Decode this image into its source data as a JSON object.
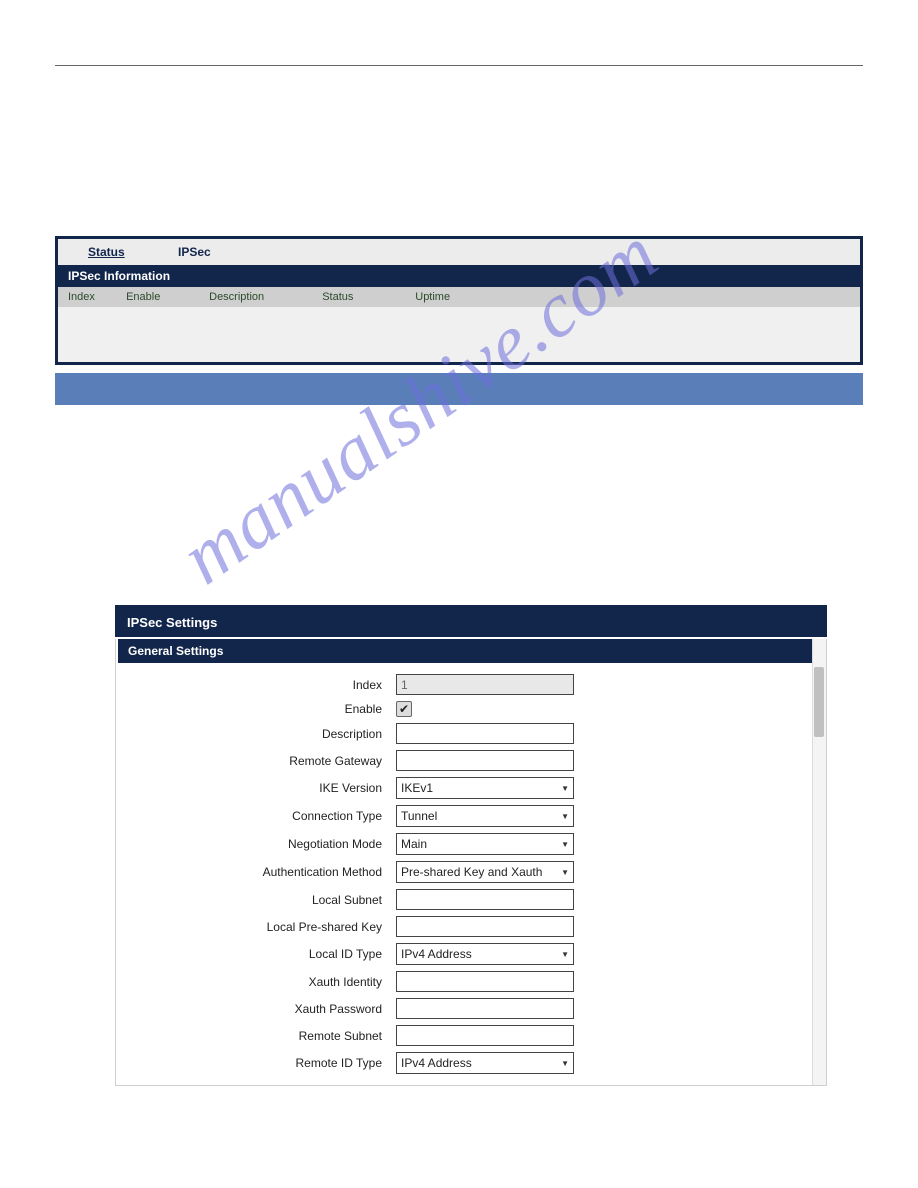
{
  "watermark": "manualshive.com",
  "ipsec_info": {
    "tabs": {
      "status": "Status",
      "ipsec": "IPSec"
    },
    "header": "IPSec Information",
    "columns": {
      "index": "Index",
      "enable": "Enable",
      "description": "Description",
      "status": "Status",
      "uptime": "Uptime"
    }
  },
  "ipsec_settings": {
    "title": "IPSec Settings",
    "general_header": "General Settings",
    "fields": {
      "index": {
        "label": "Index",
        "value": "1"
      },
      "enable": {
        "label": "Enable",
        "checked": true
      },
      "description": {
        "label": "Description",
        "value": ""
      },
      "remote_gateway": {
        "label": "Remote Gateway",
        "value": ""
      },
      "ike_version": {
        "label": "IKE Version",
        "value": "IKEv1"
      },
      "connection_type": {
        "label": "Connection Type",
        "value": "Tunnel"
      },
      "negotiation_mode": {
        "label": "Negotiation Mode",
        "value": "Main"
      },
      "auth_method": {
        "label": "Authentication Method",
        "value": "Pre-shared Key and Xauth"
      },
      "local_subnet": {
        "label": "Local Subnet",
        "value": ""
      },
      "local_psk": {
        "label": "Local Pre-shared Key",
        "value": ""
      },
      "local_id_type": {
        "label": "Local ID Type",
        "value": "IPv4 Address"
      },
      "xauth_identity": {
        "label": "Xauth Identity",
        "value": ""
      },
      "xauth_password": {
        "label": "Xauth Password",
        "value": ""
      },
      "remote_subnet": {
        "label": "Remote Subnet",
        "value": ""
      },
      "remote_id_type": {
        "label": "Remote ID Type",
        "value": "IPv4 Address"
      }
    }
  }
}
